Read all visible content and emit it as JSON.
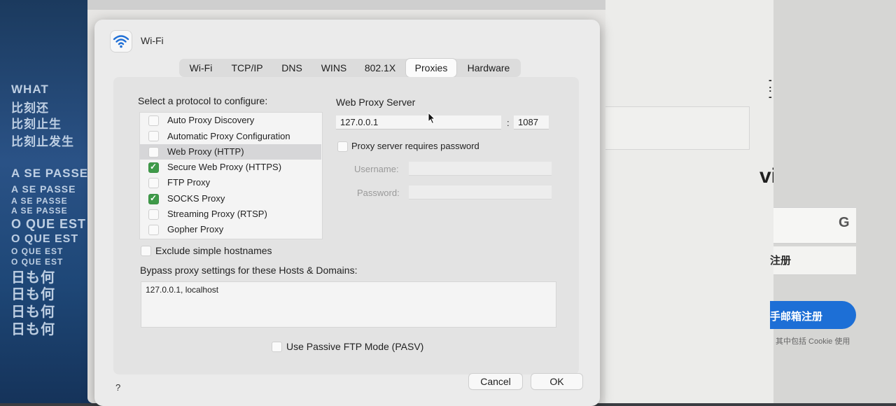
{
  "dialog": {
    "title": "Wi-Fi",
    "tabs": [
      {
        "label": "Wi-Fi"
      },
      {
        "label": "TCP/IP"
      },
      {
        "label": "DNS"
      },
      {
        "label": "WINS"
      },
      {
        "label": "802.1X"
      },
      {
        "label": "Proxies",
        "active": true
      },
      {
        "label": "Hardware"
      }
    ]
  },
  "protocols": {
    "heading": "Select a protocol to configure:",
    "items": [
      {
        "label": "Auto Proxy Discovery",
        "checked": false
      },
      {
        "label": "Automatic Proxy Configuration",
        "checked": false
      },
      {
        "label": "Web Proxy (HTTP)",
        "checked": false,
        "selected": true
      },
      {
        "label": "Secure Web Proxy (HTTPS)",
        "checked": true
      },
      {
        "label": "FTP Proxy",
        "checked": false
      },
      {
        "label": "SOCKS Proxy",
        "checked": true
      },
      {
        "label": "Streaming Proxy (RTSP)",
        "checked": false
      },
      {
        "label": "Gopher Proxy",
        "checked": false
      }
    ]
  },
  "server": {
    "heading": "Web Proxy Server",
    "host": "127.0.0.1",
    "separator": ":",
    "port": "1087",
    "requires_password_label": "Proxy server requires password",
    "requires_password": false,
    "username_label": "Username:",
    "username": "",
    "password_label": "Password:",
    "password": ""
  },
  "exclude_simple_hostnames": {
    "label": "Exclude simple hostnames",
    "checked": false
  },
  "bypass": {
    "label": "Bypass proxy settings for these Hosts & Domains:",
    "value": "127.0.0.1, localhost"
  },
  "passive_ftp": {
    "label": "Use Passive FTP Mode (PASV)",
    "checked": false
  },
  "buttons": {
    "help": "?",
    "cancel": "Cancel",
    "ok": "OK"
  },
  "background": {
    "brand": "vitter。",
    "signup_short": "注册",
    "email_signup": "手邮箱注册",
    "cookie_note": "其中包括 Cookie 使用",
    "google_glyph": "G",
    "poster_lines": [
      "WHAT",
      "比刻还",
      "比刻止生",
      "比刻止发生",
      "A SE PASSE",
      "A SE PASSE",
      "A SE PASSE",
      "A SE PASSE",
      "O QUE EST",
      "O QUE EST",
      "O QUE EST",
      "O QUE EST",
      "日も何",
      "日も何",
      "日も何",
      "日も何"
    ]
  },
  "colors": {
    "checkbox_on": "#3f9a49",
    "selection": "#d6d6d8",
    "signup_blue": "#1d6fd6"
  }
}
